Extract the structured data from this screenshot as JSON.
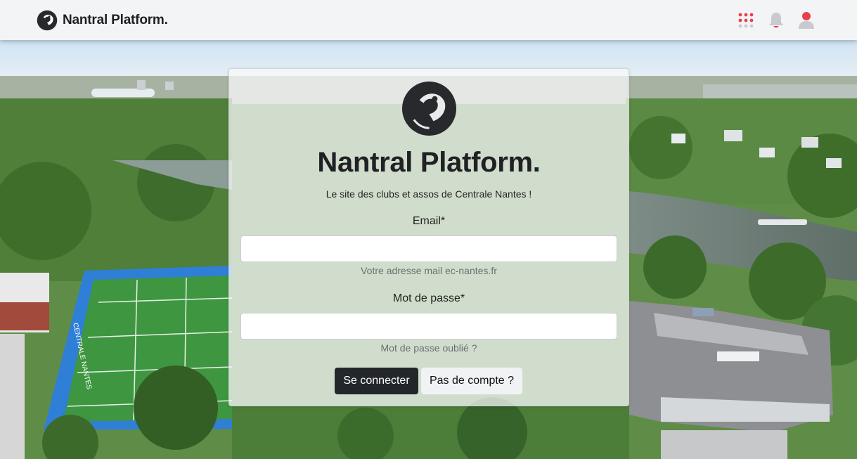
{
  "navbar": {
    "brand_name": "Nantral Platform.",
    "icons": [
      "apps-grid-icon",
      "bell-icon",
      "user-icon"
    ],
    "accent_color": "#e8414c"
  },
  "login": {
    "title": "Nantral Platform.",
    "subtitle": "Le site des clubs et assos de Centrale Nantes !",
    "email": {
      "label": "Email*",
      "value": "",
      "placeholder": "",
      "help": "Votre adresse mail ec-nantes.fr"
    },
    "password": {
      "label": "Mot de passe*",
      "value": "",
      "placeholder": "",
      "forgot_link": "Mot de passe oublié ?"
    },
    "submit_label": "Se connecter",
    "signup_label": "Pas de compte ?"
  },
  "background": {
    "field_sign_text": "CENTRALE NANTES"
  }
}
